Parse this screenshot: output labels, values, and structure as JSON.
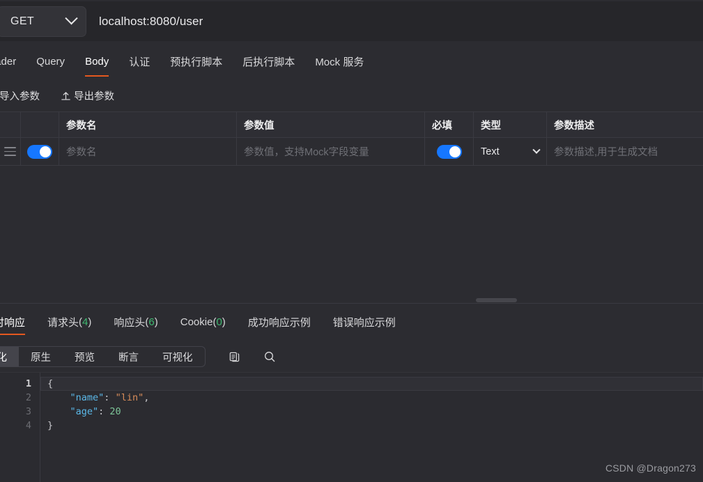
{
  "urlbar": {
    "method": "GET",
    "method_chevron_icon": "chevron-down-icon",
    "url": "localhost:8080/user"
  },
  "request_tabs": {
    "items": [
      {
        "label": "Header",
        "active": false
      },
      {
        "label": "Query",
        "active": false
      },
      {
        "label": "Body",
        "active": true
      },
      {
        "label": "认证",
        "active": false
      },
      {
        "label": "预执行脚本",
        "active": false
      },
      {
        "label": "后执行脚本",
        "active": false
      },
      {
        "label": "Mock 服务",
        "active": false
      }
    ]
  },
  "param_actions": {
    "import_label": "导入参数",
    "import_icon": "download-icon",
    "export_label": "导出参数",
    "export_icon": "upload-icon"
  },
  "param_table": {
    "columns": [
      "",
      "",
      "参数名",
      "参数值",
      "必填",
      "类型",
      "参数描述"
    ],
    "rows": [
      {
        "handle_icon": "drag-handle-icon",
        "enabled": true,
        "name_placeholder": "参数名",
        "name_value": "",
        "value_type": "Text",
        "value_placeholder": "参数值，支持Mock字段变量",
        "value_value": "",
        "required": true,
        "type": "Text",
        "desc_placeholder": "参数描述,用于生成文档",
        "desc_value": ""
      }
    ]
  },
  "response_tabs": {
    "items": [
      {
        "label": "实时响应",
        "count": null,
        "active": true
      },
      {
        "label": "请求头",
        "count": "4",
        "active": false
      },
      {
        "label": "响应头",
        "count": "6",
        "active": false
      },
      {
        "label": "Cookie",
        "count": "0",
        "active": false
      },
      {
        "label": "成功响应示例",
        "count": null,
        "active": false
      },
      {
        "label": "错误响应示例",
        "count": null,
        "active": false
      }
    ]
  },
  "viewer_toolbar": {
    "segments": [
      {
        "label": "美化",
        "active": true
      },
      {
        "label": "原生",
        "active": false
      },
      {
        "label": "预览",
        "active": false
      },
      {
        "label": "断言",
        "active": false
      },
      {
        "label": "可视化",
        "active": false
      }
    ],
    "copy_icon": "copy-icon",
    "search_icon": "search-icon"
  },
  "code_viewer": {
    "line_numbers": [
      "1",
      "2",
      "3",
      "4"
    ],
    "lines": [
      {
        "raw": "{",
        "tokens": [
          {
            "t": "{",
            "c": "punct"
          }
        ]
      },
      {
        "raw": "    \"name\": \"lin\",",
        "tokens": [
          {
            "t": "    ",
            "c": "punct"
          },
          {
            "t": "\"name\"",
            "c": "key"
          },
          {
            "t": ": ",
            "c": "punct"
          },
          {
            "t": "\"lin\"",
            "c": "str"
          },
          {
            "t": ",",
            "c": "punct"
          }
        ]
      },
      {
        "raw": "    \"age\": 20",
        "tokens": [
          {
            "t": "    ",
            "c": "punct"
          },
          {
            "t": "\"age\"",
            "c": "key"
          },
          {
            "t": ": ",
            "c": "punct"
          },
          {
            "t": "20",
            "c": "num"
          }
        ]
      },
      {
        "raw": "}",
        "tokens": [
          {
            "t": "}",
            "c": "punct"
          }
        ]
      }
    ]
  },
  "watermark": "CSDN @Dragon273",
  "colors": {
    "accent_orange": "#e4581f",
    "toggle_blue": "#1677ff",
    "count_green": "#3fba71",
    "bg": "#2c2c31",
    "bg_dark": "#26262a"
  }
}
